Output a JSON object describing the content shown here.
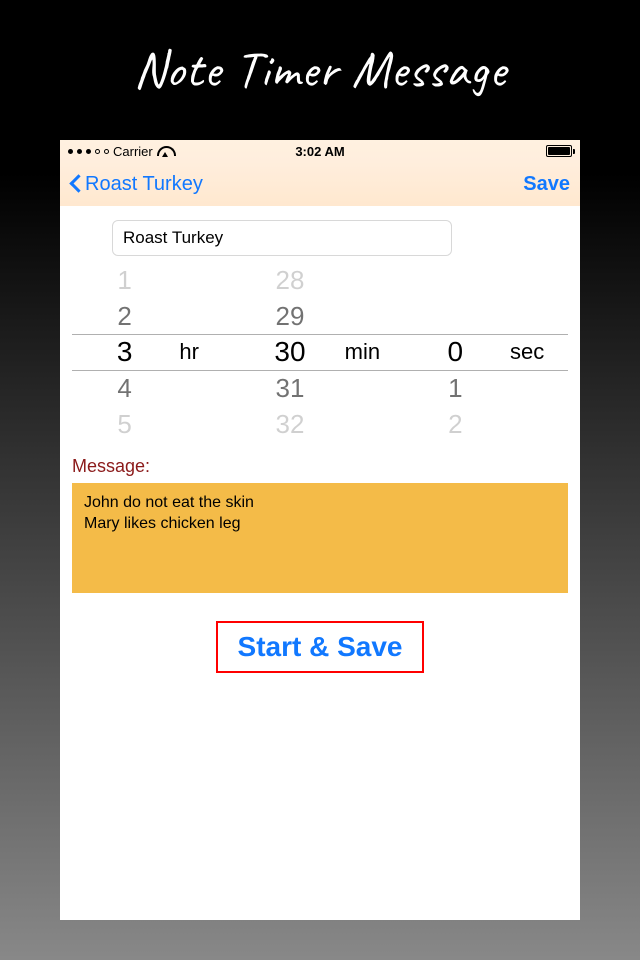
{
  "promo": {
    "title": "Note Timer Message"
  },
  "statusbar": {
    "carrier": "Carrier",
    "time": "3:02 AM"
  },
  "navbar": {
    "back_label": "Roast Turkey",
    "save_label": "Save"
  },
  "form": {
    "name_value": "Roast Turkey",
    "picker": {
      "hr_label": "hr",
      "min_label": "min",
      "sec_label": "sec",
      "hours": {
        "prev2": "1",
        "prev1": "2",
        "sel": "3",
        "next1": "4",
        "next2": "5"
      },
      "minutes": {
        "prev2": "28",
        "prev1": "29",
        "sel": "30",
        "next1": "31",
        "next2": "32"
      },
      "seconds": {
        "prev2": "",
        "prev1": "",
        "sel": "0",
        "next1": "1",
        "next2": "2"
      }
    },
    "message_label": "Message:",
    "message_text": "John do not eat the skin\nMary likes chicken leg",
    "start_save_label": "Start & Save"
  }
}
